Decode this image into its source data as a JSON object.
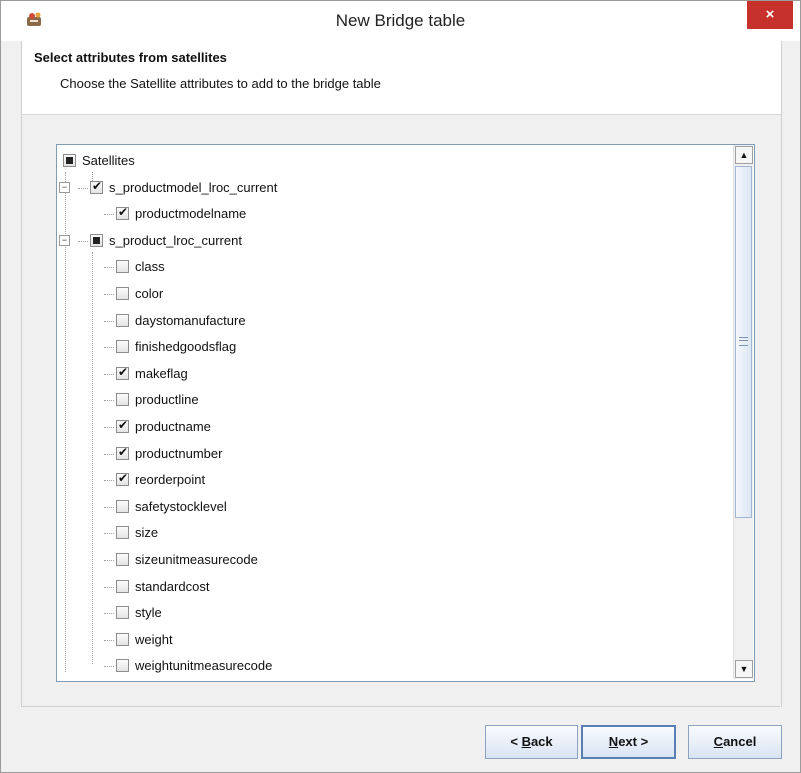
{
  "window": {
    "title": "New Bridge table",
    "close_symbol": "×"
  },
  "header": {
    "title": "Select attributes from satellites",
    "description": "Choose the Satellite attributes to add to the bridge table"
  },
  "tree": {
    "root": {
      "label": "Satellites",
      "state": "partial"
    },
    "groups": [
      {
        "label": "s_productmodel_lroc_current",
        "state": "checked",
        "expander": "−",
        "children": [
          {
            "label": "productmodelname",
            "checked": true
          }
        ]
      },
      {
        "label": "s_product_lroc_current",
        "state": "partial",
        "expander": "−",
        "children": [
          {
            "label": "class",
            "checked": false
          },
          {
            "label": "color",
            "checked": false
          },
          {
            "label": "daystomanufacture",
            "checked": false
          },
          {
            "label": "finishedgoodsflag",
            "checked": false
          },
          {
            "label": "makeflag",
            "checked": true
          },
          {
            "label": "productline",
            "checked": false
          },
          {
            "label": "productname",
            "checked": true
          },
          {
            "label": "productnumber",
            "checked": true
          },
          {
            "label": "reorderpoint",
            "checked": true
          },
          {
            "label": "safetystocklevel",
            "checked": false
          },
          {
            "label": "size",
            "checked": false
          },
          {
            "label": "sizeunitmeasurecode",
            "checked": false
          },
          {
            "label": "standardcost",
            "checked": false
          },
          {
            "label": "style",
            "checked": false
          },
          {
            "label": "weight",
            "checked": false
          },
          {
            "label": "weightunitmeasurecode",
            "checked": false
          }
        ]
      }
    ]
  },
  "scrollbar": {
    "up_symbol": "▲",
    "down_symbol": "▼"
  },
  "buttons": {
    "back": {
      "prefix": "< ",
      "mnemonic": "B",
      "rest": "ack"
    },
    "next": {
      "mnemonic": "N",
      "rest": "ext",
      "suffix": " >"
    },
    "cancel": {
      "mnemonic": "C",
      "rest": "ancel"
    }
  },
  "colors": {
    "close": "#c7312b",
    "button_border": "#8da2c1",
    "tree_border": "#7f9db9"
  }
}
